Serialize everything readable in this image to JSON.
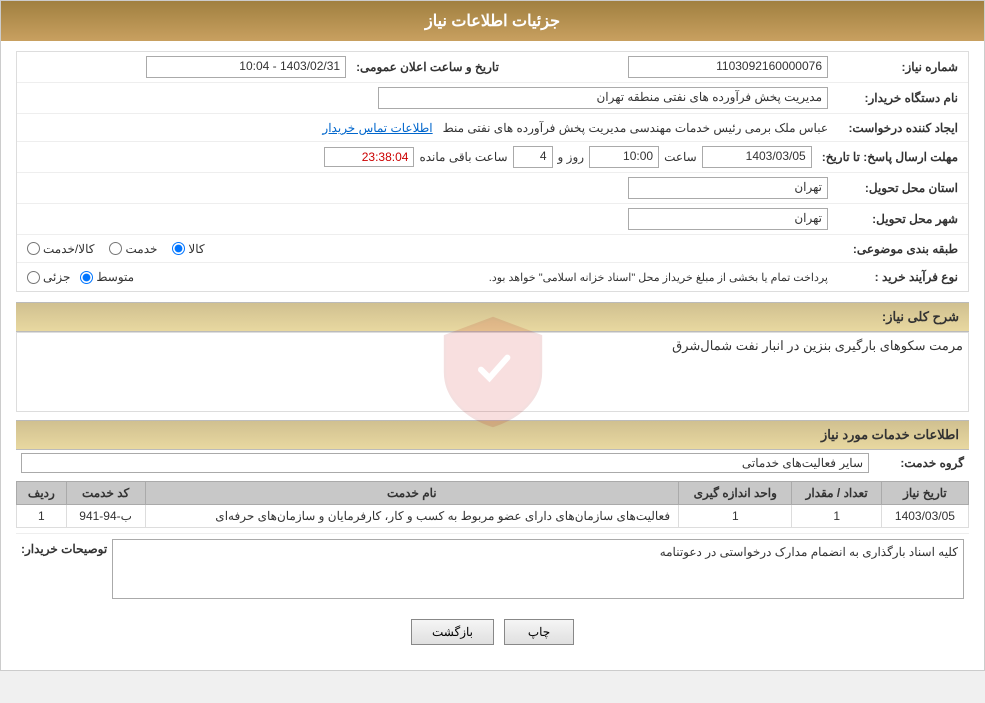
{
  "header": {
    "title": "جزئیات اطلاعات نیاز"
  },
  "main": {
    "need_number_label": "شماره نیاز:",
    "need_number_value": "1103092160000076",
    "date_announce_label": "تاریخ و ساعت اعلان عمومی:",
    "date_announce_value": "1403/02/31 - 10:04",
    "buyer_org_label": "نام دستگاه خریدار:",
    "buyer_org_value": "مدیریت پخش فرآورده های نفتی منطقه تهران",
    "creator_label": "ایجاد کننده درخواست:",
    "creator_value": "عباس ملک برمی رئیس خدمات مهندسی مدیریت پخش فرآورده های نفتی منط",
    "creator_link": "اطلاعات تماس خریدار",
    "response_deadline_label": "مهلت ارسال پاسخ: تا تاریخ:",
    "response_date_value": "1403/03/05",
    "response_time_label": "ساعت",
    "response_time_value": "10:00",
    "response_day_label": "روز و",
    "response_day_value": "4",
    "remaining_label": "ساعت باقی مانده",
    "remaining_value": "23:38:04",
    "province_label": "استان محل تحویل:",
    "province_value": "تهران",
    "city_label": "شهر محل تحویل:",
    "city_value": "تهران",
    "category_label": "طبقه بندی موضوعی:",
    "category_options": [
      {
        "label": "کالا",
        "value": "kala",
        "selected": true
      },
      {
        "label": "خدمت",
        "value": "khedmat",
        "selected": false
      },
      {
        "label": "کالا/خدمت",
        "value": "kala_khedmat",
        "selected": false
      }
    ],
    "purchase_type_label": "نوع فرآیند خرید :",
    "purchase_type_options": [
      {
        "label": "جزئی",
        "value": "jozi",
        "selected": false
      },
      {
        "label": "متوسط",
        "value": "motavaset",
        "selected": true
      }
    ],
    "purchase_note": "پرداخت تمام یا بخشی از مبلغ خریداز محل \"اسناد خزانه اسلامی\" خواهد بود.",
    "general_description_label": "شرح کلی نیاز:",
    "general_description_value": "مرمت سکوهای بارگیری بنزین در انبار نفت شمال‌شرق",
    "services_section_label": "اطلاعات خدمات مورد نیاز",
    "service_group_label": "گروه خدمت:",
    "service_group_value": "سایر فعالیت‌های خدماتی",
    "table": {
      "headers": [
        "ردیف",
        "کد خدمت",
        "نام خدمت",
        "واحد اندازه گیری",
        "تعداد / مقدار",
        "تاریخ نیاز"
      ],
      "rows": [
        {
          "row": "1",
          "code": "ب-94-941",
          "name": "فعالیت‌های سازمان‌های دارای عضو مربوط به کسب و کار، کارفرمایان و سازمان‌های حرفه‌ای",
          "unit": "1",
          "quantity": "1",
          "date": "1403/03/05"
        }
      ]
    },
    "buyer_notes_label": "توصیحات خریدار:",
    "buyer_notes_value": "کلیه اسناد بارگذاری به انضمام مدارک درخواستی در دعوتنامه",
    "print_button": "چاپ",
    "back_button": "بازگشت"
  }
}
